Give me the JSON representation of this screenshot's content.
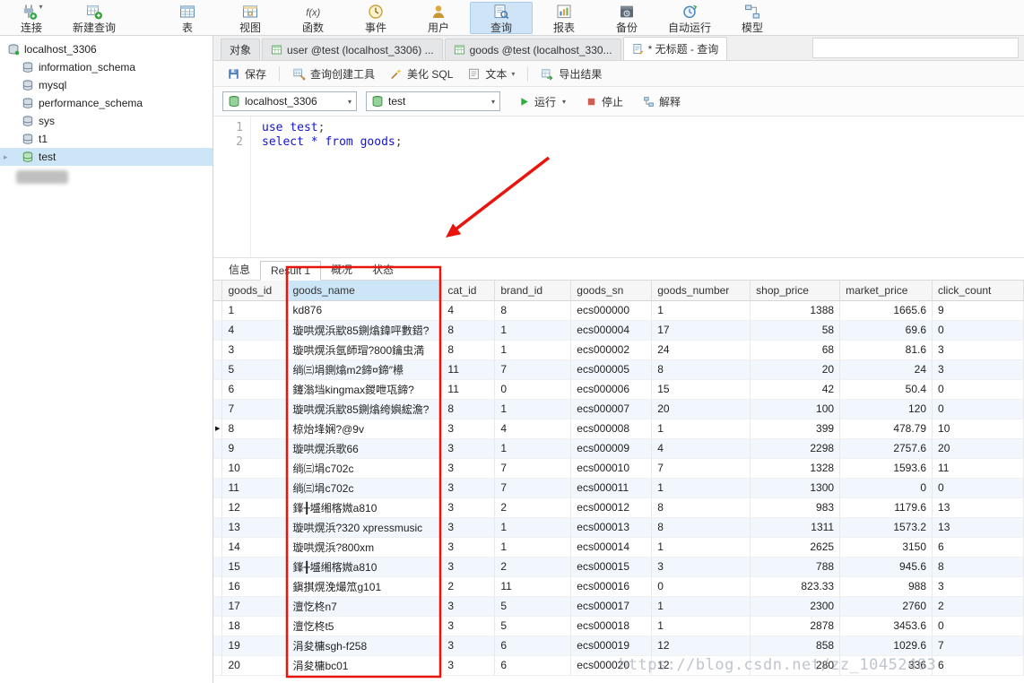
{
  "top_toolbar": {
    "items": [
      {
        "name": "connection",
        "label": "连接",
        "icon": "connection-icon",
        "dropdown": true,
        "active": false
      },
      {
        "name": "new-query",
        "label": "新建查询",
        "icon": "new-query-icon",
        "dropdown": false,
        "active": false
      },
      {
        "name": "table",
        "label": "表",
        "icon": "table-icon",
        "active": false
      },
      {
        "name": "view",
        "label": "视图",
        "icon": "view-icon",
        "active": false
      },
      {
        "name": "function",
        "label": "函数",
        "icon": "function-icon",
        "active": false
      },
      {
        "name": "event",
        "label": "事件",
        "icon": "event-icon",
        "active": false
      },
      {
        "name": "user",
        "label": "用户",
        "icon": "user-icon",
        "active": false
      },
      {
        "name": "query",
        "label": "查询",
        "icon": "query-icon",
        "active": true
      },
      {
        "name": "report",
        "label": "报表",
        "icon": "report-icon",
        "active": false
      },
      {
        "name": "backup",
        "label": "备份",
        "icon": "backup-icon",
        "active": false
      },
      {
        "name": "automation",
        "label": "自动运行",
        "icon": "automation-icon",
        "active": false
      },
      {
        "name": "model",
        "label": "模型",
        "icon": "model-icon",
        "active": false
      }
    ]
  },
  "sidebar": {
    "items": [
      {
        "name": "localhost-3306",
        "label": "localhost_3306",
        "level": 0,
        "icon": "connection-db-icon",
        "selected": false,
        "chevron": false
      },
      {
        "name": "information-schema",
        "label": "information_schema",
        "level": 1,
        "icon": "database-icon",
        "selected": false,
        "chevron": false
      },
      {
        "name": "mysql",
        "label": "mysql",
        "level": 1,
        "icon": "database-icon",
        "selected": false,
        "chevron": false
      },
      {
        "name": "performance-schema",
        "label": "performance_schema",
        "level": 1,
        "icon": "database-icon",
        "selected": false,
        "chevron": false
      },
      {
        "name": "sys",
        "label": "sys",
        "level": 1,
        "icon": "database-icon",
        "selected": false,
        "chevron": false
      },
      {
        "name": "t1",
        "label": "t1",
        "level": 1,
        "icon": "database-icon",
        "selected": false,
        "chevron": false
      },
      {
        "name": "test",
        "label": "test",
        "level": 1,
        "icon": "database-open-icon",
        "selected": true,
        "chevron": true
      }
    ]
  },
  "doc_tabs": [
    {
      "name": "objects",
      "label": "对象",
      "icon": null,
      "active": false
    },
    {
      "name": "table-user",
      "label": "user @test (localhost_3306) ...",
      "icon": "table-tab-icon",
      "active": false
    },
    {
      "name": "table-goods",
      "label": "goods @test (localhost_330...",
      "icon": "table-tab-icon",
      "active": false
    },
    {
      "name": "query-untitled",
      "label": "* 无标题 - 查询",
      "icon": "query-tab-icon",
      "active": true
    }
  ],
  "query_toolbar": {
    "buttons": [
      {
        "name": "save-button",
        "label": "保存",
        "icon": "save-icon",
        "dropdown": false,
        "group_end": true
      },
      {
        "name": "query-builder-button",
        "label": "查询创建工具",
        "icon": "query-builder-icon",
        "dropdown": false,
        "group_end": false
      },
      {
        "name": "beautify-sql-button",
        "label": "美化 SQL",
        "icon": "beautify-sql-icon",
        "dropdown": false,
        "group_end": false
      },
      {
        "name": "text-mode-button",
        "label": "文本",
        "icon": "text-mode-icon",
        "dropdown": true,
        "group_end": true
      },
      {
        "name": "export-result-button",
        "label": "导出结果",
        "icon": "export-result-icon",
        "dropdown": false,
        "group_end": false
      }
    ]
  },
  "connection_bar": {
    "connection_select": "localhost_3306",
    "database_select": "test",
    "run_label": "运行",
    "stop_label": "停止",
    "explain_label": "解释"
  },
  "editor": {
    "lines": [
      {
        "num": "1",
        "tokens": [
          {
            "text": "use",
            "type": "kw"
          },
          {
            "text": " ",
            "type": "pl"
          },
          {
            "text": "test",
            "type": "id"
          },
          {
            "text": ";",
            "type": "pu"
          }
        ]
      },
      {
        "num": "2",
        "tokens": [
          {
            "text": "select",
            "type": "kw"
          },
          {
            "text": " ",
            "type": "pl"
          },
          {
            "text": "*",
            "type": "id"
          },
          {
            "text": " ",
            "type": "pl"
          },
          {
            "text": "from",
            "type": "kw"
          },
          {
            "text": " ",
            "type": "pl"
          },
          {
            "text": "goods",
            "type": "id"
          },
          {
            "text": ";",
            "type": "pu"
          }
        ]
      }
    ]
  },
  "result_tabs": [
    {
      "name": "info",
      "label": "信息",
      "active": false
    },
    {
      "name": "result-1",
      "label": "Result 1",
      "active": true
    },
    {
      "name": "profile",
      "label": "概况",
      "active": false
    },
    {
      "name": "status",
      "label": "状态",
      "active": false
    }
  ],
  "grid": {
    "columns": [
      "goods_id",
      "goods_name",
      "cat_id",
      "brand_id",
      "goods_sn",
      "goods_number",
      "shop_price",
      "market_price",
      "click_count"
    ],
    "selected_column": "goods_name",
    "current_row_index": 6,
    "rows": [
      [
        "1",
        "kd876",
        "4",
        "8",
        "ecs000000",
        "1",
        "1388",
        "1665.6",
        "9"
      ],
      [
        "4",
        "璇哄熀浜歂85鍘熻鍏呯數鍣?",
        "8",
        "1",
        "ecs000004",
        "17",
        "58",
        "69.6",
        "0"
      ],
      [
        "3",
        "璇哄熀浜氬師瑁?800鑰虫満",
        "8",
        "1",
        "ecs000002",
        "24",
        "68",
        "81.6",
        "3"
      ],
      [
        "5",
        "绱㈢埍鍘熻m2鍗¤鍗″櫒",
        "11",
        "7",
        "ecs000005",
        "8",
        "20",
        "24",
        "3"
      ],
      [
        "6",
        "鑳滃垱kingmax鍐呭瓨鍗?",
        "11",
        "0",
        "ecs000006",
        "15",
        "42",
        "50.4",
        "0"
      ],
      [
        "7",
        "璇哄熀浜歂85鍘熻绔嬩綋澹?",
        "8",
        "1",
        "ecs000007",
        "20",
        "100",
        "120",
        "0"
      ],
      [
        "8",
        "椋炲埄娴?@9v",
        "3",
        "4",
        "ecs000008",
        "1",
        "399",
        "478.79",
        "10"
      ],
      [
        "9",
        "璇哄熀浜歌66",
        "3",
        "1",
        "ecs000009",
        "4",
        "2298",
        "2757.6",
        "20"
      ],
      [
        "10",
        "绱㈢埍c702c",
        "3",
        "7",
        "ecs000010",
        "7",
        "1328",
        "1593.6",
        "11"
      ],
      [
        "11",
        "绱㈢埍c702c",
        "3",
        "7",
        "ecs000011",
        "1",
        "1300",
        "0",
        "0"
      ],
      [
        "12",
        "鎽╂墭缃楁媺a810",
        "3",
        "2",
        "ecs000012",
        "8",
        "983",
        "1179.6",
        "13"
      ],
      [
        "13",
        "璇哄熀浜?320 xpressmusic",
        "3",
        "1",
        "ecs000013",
        "8",
        "1311",
        "1573.2",
        "13"
      ],
      [
        "14",
        "璇哄熀浜?800xm",
        "3",
        "1",
        "ecs000014",
        "1",
        "2625",
        "3150",
        "6"
      ],
      [
        "15",
        "鎽╂墭缃楁媺a810",
        "3",
        "2",
        "ecs000015",
        "3",
        "788",
        "945.6",
        "8"
      ],
      [
        "16",
        "鎭掑熀浼熶笟g101",
        "2",
        "11",
        "ecs000016",
        "0",
        "823.33",
        "988",
        "3"
      ],
      [
        "17",
        "澶忔柊n7",
        "3",
        "5",
        "ecs000017",
        "1",
        "2300",
        "2760",
        "2"
      ],
      [
        "18",
        "澶忔柊t5",
        "3",
        "5",
        "ecs000018",
        "1",
        "2878",
        "3453.6",
        "0"
      ],
      [
        "19",
        "涓夋槦sgh-f258",
        "3",
        "6",
        "ecs000019",
        "12",
        "858",
        "1029.6",
        "7"
      ],
      [
        "20",
        "涓夋槦bc01",
        "3",
        "6",
        "ecs000020",
        "12",
        "280",
        "336",
        "6"
      ]
    ]
  },
  "watermark": "https://blog.csdn.net/zz_10452483",
  "colors": {
    "annotation_red": "#e8150d",
    "selection_blue": "#cde6f7",
    "keyword_blue": "#1313d6"
  }
}
